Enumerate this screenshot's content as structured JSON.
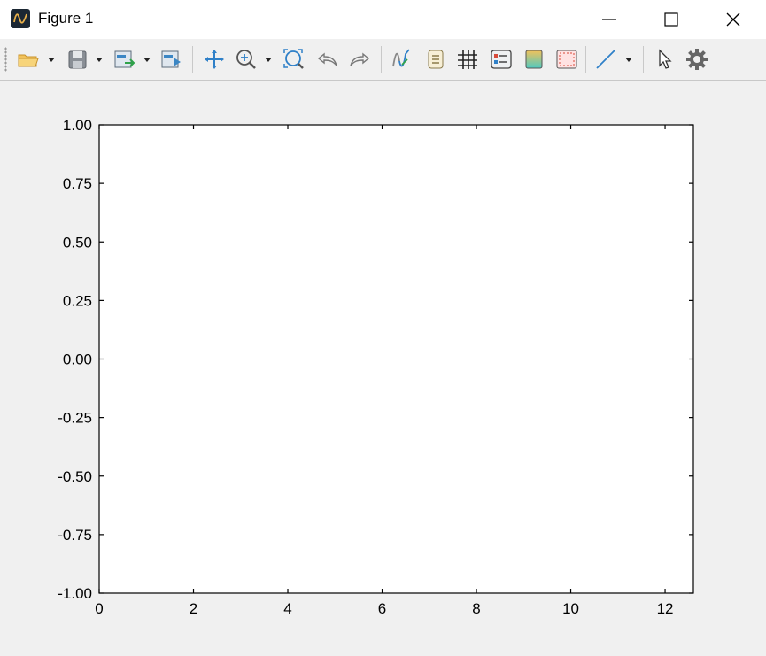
{
  "window": {
    "title": "Figure 1"
  },
  "toolbar": {
    "items": [
      "open-icon",
      "save-icon",
      "export-icon",
      "export-data-icon",
      "pan-icon",
      "zoom-icon",
      "fit-view-icon",
      "undo-icon",
      "redo-icon",
      "signal-icon",
      "legend-icon",
      "grid-icon",
      "properties-icon",
      "colormap-icon",
      "frame-icon",
      "line-style-icon",
      "pointer-icon",
      "settings-icon"
    ]
  },
  "chart_data": {
    "type": "line",
    "series": [],
    "xlim": [
      0,
      12.6
    ],
    "ylim": [
      -1.0,
      1.0
    ],
    "xticks": [
      "0",
      "2",
      "4",
      "6",
      "8",
      "10",
      "12"
    ],
    "yticks": [
      "1.00",
      "0.75",
      "0.50",
      "0.25",
      "0.00",
      "-0.25",
      "-0.50",
      "-0.75",
      "-1.00"
    ],
    "xtick_values": [
      0,
      2,
      4,
      6,
      8,
      10,
      12
    ],
    "ytick_values": [
      1.0,
      0.75,
      0.5,
      0.25,
      0.0,
      -0.25,
      -0.5,
      -0.75,
      -1.0
    ],
    "grid": false,
    "colors": {
      "axes": "#000000",
      "background": "#ffffff"
    }
  }
}
